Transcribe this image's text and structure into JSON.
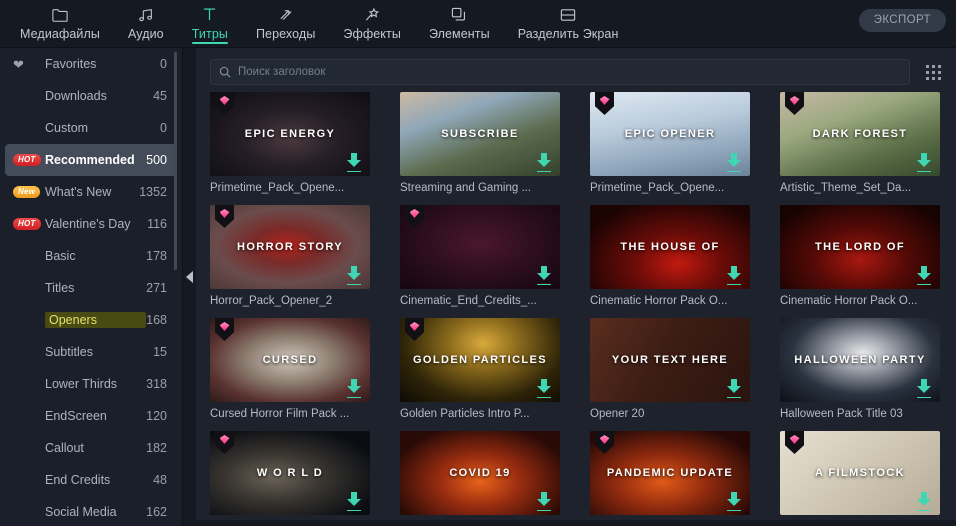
{
  "topbar": {
    "tabs": [
      {
        "label": "Медиафайлы",
        "icon": "folder-icon",
        "active": false
      },
      {
        "label": "Аудио",
        "icon": "music-note-icon",
        "active": false
      },
      {
        "label": "Титры",
        "icon": "text-t-icon",
        "active": true
      },
      {
        "label": "Переходы",
        "icon": "transition-arrows-icon",
        "active": false
      },
      {
        "label": "Эффекты",
        "icon": "magic-wand-icon",
        "active": false
      },
      {
        "label": "Элементы",
        "icon": "layers-icon",
        "active": false
      },
      {
        "label": "Разделить Экран",
        "icon": "split-screen-icon",
        "active": false
      }
    ],
    "export_label": "ЭКСПОРТ",
    "accent_color": "#3fd6b4"
  },
  "sidebar": {
    "items": [
      {
        "label": "Favorites",
        "count": "0",
        "badge": "",
        "icon": "heart-icon",
        "selected": false,
        "highlight": false
      },
      {
        "label": "Downloads",
        "count": "45",
        "badge": "",
        "icon": "",
        "selected": false,
        "highlight": false
      },
      {
        "label": "Custom",
        "count": "0",
        "badge": "",
        "icon": "",
        "selected": false,
        "highlight": false
      },
      {
        "label": "Recommended",
        "count": "500",
        "badge": "HOT",
        "icon": "",
        "selected": true,
        "highlight": false
      },
      {
        "label": "What's New",
        "count": "1352",
        "badge": "New",
        "icon": "",
        "selected": false,
        "highlight": false
      },
      {
        "label": "Valentine's Day",
        "count": "116",
        "badge": "HOT",
        "icon": "",
        "selected": false,
        "highlight": false
      },
      {
        "label": "Basic",
        "count": "178",
        "badge": "",
        "icon": "",
        "selected": false,
        "highlight": false
      },
      {
        "label": "Titles",
        "count": "271",
        "badge": "",
        "icon": "",
        "selected": false,
        "highlight": false
      },
      {
        "label": "Openers",
        "count": "168",
        "badge": "",
        "icon": "",
        "selected": false,
        "highlight": true
      },
      {
        "label": "Subtitles",
        "count": "15",
        "badge": "",
        "icon": "",
        "selected": false,
        "highlight": false
      },
      {
        "label": "Lower Thirds",
        "count": "318",
        "badge": "",
        "icon": "",
        "selected": false,
        "highlight": false
      },
      {
        "label": "EndScreen",
        "count": "120",
        "badge": "",
        "icon": "",
        "selected": false,
        "highlight": false
      },
      {
        "label": "Callout",
        "count": "182",
        "badge": "",
        "icon": "",
        "selected": false,
        "highlight": false
      },
      {
        "label": "End Credits",
        "count": "48",
        "badge": "",
        "icon": "",
        "selected": false,
        "highlight": false
      },
      {
        "label": "Social Media",
        "count": "162",
        "badge": "",
        "icon": "",
        "selected": false,
        "highlight": false
      }
    ]
  },
  "search": {
    "placeholder": "Поиск заголовок",
    "value": "",
    "icon": "search-icon",
    "view_toggle_icon": "grid-view-icon"
  },
  "grid": {
    "items": [
      {
        "caption": "Primetime_Pack_Opene...",
        "art_text": "EPIC ENERGY",
        "premium": true,
        "downloadable": true,
        "bg": "radial-gradient(ellipse at 50% 55%, #4a3a3e 0%, #241d26 45%, #0e0d12 100%)"
      },
      {
        "caption": "Streaming and Gaming ...",
        "art_text": "SUBSCRIBE",
        "premium": false,
        "downloadable": true,
        "bg": "linear-gradient(160deg,#cdb9a3 0%,#8fa7b8 30%,#5c6b4e 62%,#33412c 100%)"
      },
      {
        "caption": "Primetime_Pack_Opene...",
        "art_text": "EPIC OPENER",
        "premium": true,
        "downloadable": true,
        "bg": "linear-gradient(170deg,#dfe9f2 0%,#b9cbdc 40%,#8ca3b8 75%,#6b8298 100%)"
      },
      {
        "caption": "Artistic_Theme_Set_Da...",
        "art_text": "DARK FOREST",
        "premium": true,
        "downloadable": true,
        "bg": "linear-gradient(160deg,#c8b9a6 0%,#9aa87f 35%,#5d7049 68%,#35482c 100%)"
      },
      {
        "caption": "Horror_Pack_Opener_2",
        "art_text": "HORROR STORY",
        "premium": true,
        "downloadable": true,
        "bg": "radial-gradient(ellipse at 48% 48%, #b2221c 0%, #7a2a28 28%, #6b4c4c 60%, #4a3636 100%)"
      },
      {
        "caption": "Cinematic_End_Credits_...",
        "art_text": "",
        "premium": true,
        "downloadable": true,
        "bg": "radial-gradient(ellipse at 50% 45%, #4a1630 0%, #2a0d1e 55%, #140610 100%)"
      },
      {
        "caption": "Cinematic Horror Pack O...",
        "art_text": "THE HOUSE OF",
        "premium": false,
        "downloadable": true,
        "bg": "radial-gradient(ellipse at 55% 70%, #c01a10 0%, #6b0c08 35%, #1c0403 80%)"
      },
      {
        "caption": "Cinematic Horror Pack O...",
        "art_text": "THE LORD OF",
        "premium": false,
        "downloadable": true,
        "bg": "radial-gradient(ellipse at 50% 65%, #a81810 0%, #560a06 40%, #170302 85%)"
      },
      {
        "caption": "Cursed Horror Film Pack ...",
        "art_text": "CURSED",
        "premium": true,
        "downloadable": true,
        "bg": "radial-gradient(ellipse at 50% 50%, #cfc6ba 0%, #8e7f72 38%, #5a3330 72%, #2e1a18 100%)"
      },
      {
        "caption": "Golden Particles Intro P...",
        "art_text": "GOLDEN PARTICLES",
        "premium": true,
        "downloadable": true,
        "bg": "radial-gradient(ellipse at 52% 30%, #d9a93c 0%, #8a6a1c 30%, #2e2408 68%, #0c0a04 100%)"
      },
      {
        "caption": "Opener 20",
        "art_text": "YOUR TEXT HERE",
        "premium": false,
        "downloadable": true,
        "bg": "linear-gradient(120deg,#5a2e1f 0%,#3d1d14 45%,#2a140e 100%)"
      },
      {
        "caption": "Halloween Pack Title 03",
        "art_text": "HALLOWEEN PARTY",
        "premium": false,
        "downloadable": true,
        "bg": "radial-gradient(ellipse at 52% 42%, #e8e8e8 0%, #9a9fa8 25%, #2b3340 60%, #0b0f16 100%)"
      },
      {
        "caption": "",
        "art_text": "W O R L D",
        "premium": true,
        "downloadable": true,
        "bg": "radial-gradient(ellipse at 40% 55%, #6b6358 0%, #3a3631 35%, #0a0d12 80%)"
      },
      {
        "caption": "",
        "art_text": "COVID 19",
        "premium": false,
        "downloadable": true,
        "bg": "radial-gradient(ellipse at 50% 60%, #e8631a 0%, #9a2d10 35%, #2a0a06 80%)"
      },
      {
        "caption": "",
        "art_text": "PANDEMIC UPDATE",
        "premium": true,
        "downloadable": true,
        "bg": "radial-gradient(ellipse at 45% 60%, #e05a18 0%, #8f2a0e 38%, #250806 82%)"
      },
      {
        "caption": "",
        "art_text": "A FILMSTOCK",
        "premium": true,
        "downloadable": true,
        "bg": "linear-gradient(140deg,#e6e0d2 0%,#cfc7b4 50%,#b5ac98 100%)"
      }
    ]
  }
}
